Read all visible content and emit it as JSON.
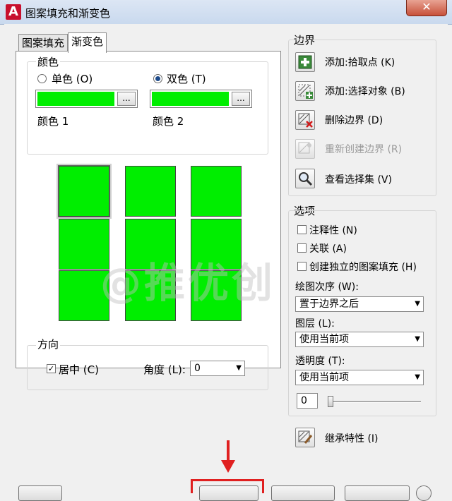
{
  "window": {
    "title": "图案填充和渐变色",
    "close_glyph": "✕",
    "logo_letter": "A"
  },
  "tabs": [
    {
      "label": "图案填充"
    },
    {
      "label": "渐变色"
    }
  ],
  "color_section": {
    "title": "颜色",
    "single_label": "单色 (O)",
    "double_label": "双色 (T)",
    "selected": "double",
    "color1_label": "颜色 1",
    "color2_label": "颜色 2",
    "color1": "#00ee00",
    "color2": "#00ee00",
    "browse_label": "..."
  },
  "gradient_swatch_count": 9,
  "direction": {
    "title": "方向",
    "centered_label": "居中 (C)",
    "centered_checked": true,
    "angle_label": "角度 (L):",
    "angle_value": "0"
  },
  "boundary": {
    "title": "边界",
    "add_pick": "添加:拾取点 (K)",
    "add_select": "添加:选择对象 (B)",
    "remove": "删除边界 (D)",
    "recreate": "重新创建边界 (R)",
    "view_selection": "查看选择集 (V)"
  },
  "options": {
    "title": "选项",
    "annotative": "注释性 (N)",
    "associative": "关联 (A)",
    "separate": "创建独立的图案填充 (H)",
    "draw_order_label": "绘图次序 (W):",
    "draw_order_value": "置于边界之后",
    "layer_label": "图层 (L):",
    "layer_value": "使用当前项",
    "transparency_label": "透明度 (T):",
    "transparency_value": "使用当前项",
    "transparency_amount": "0"
  },
  "inherit": "继承特性 (I)",
  "watermark": "@推优创"
}
